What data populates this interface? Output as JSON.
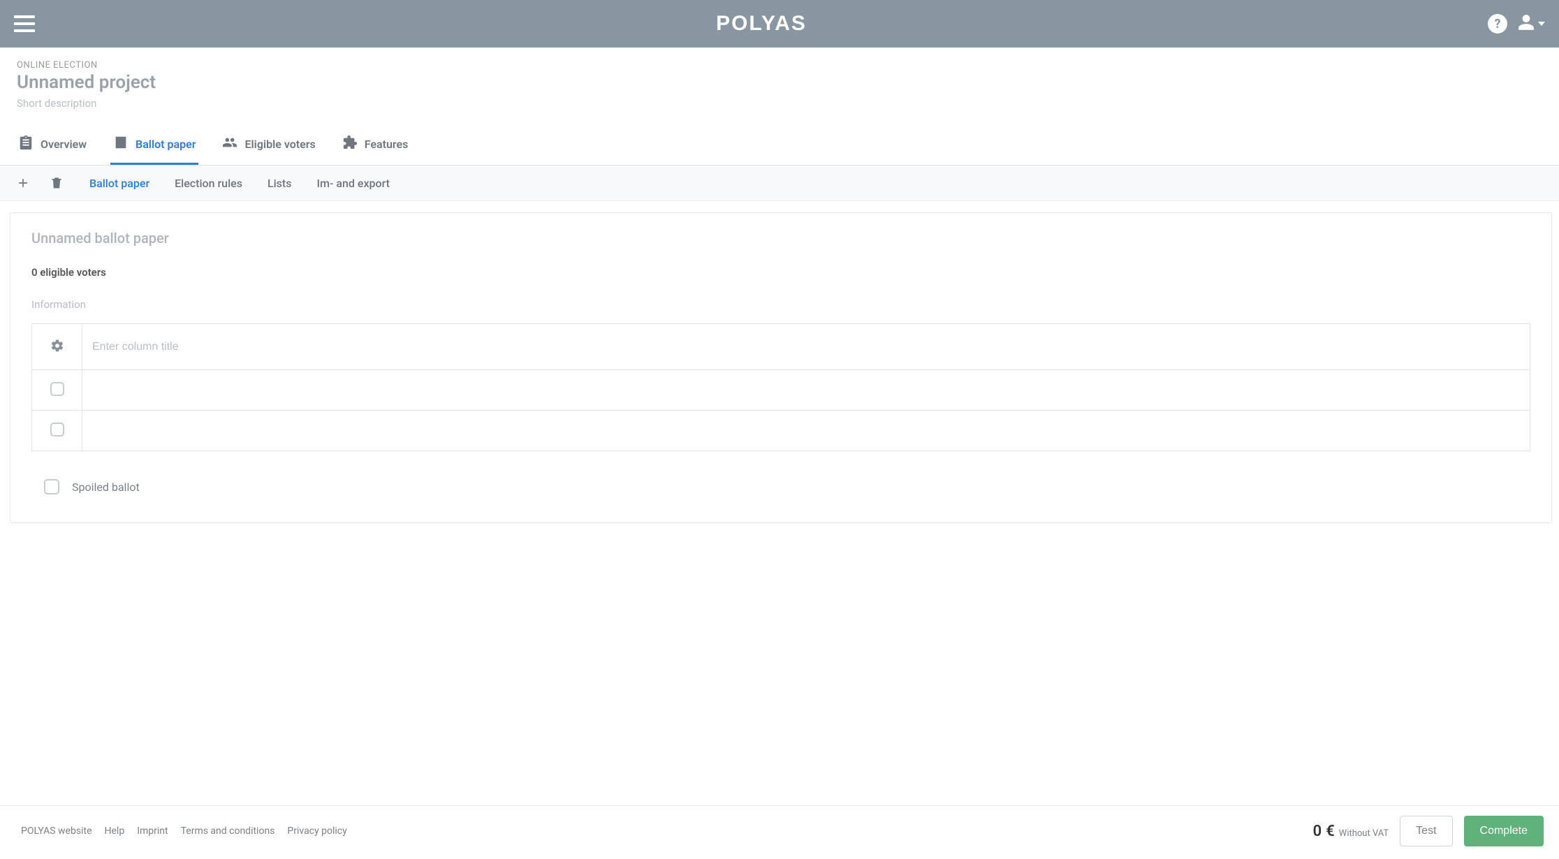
{
  "brand": "POLYAS",
  "project": {
    "eyebrow": "ONLINE ELECTION",
    "title": "Unnamed project",
    "description": "Short description"
  },
  "tabs": {
    "overview": "Overview",
    "ballot_paper": "Ballot paper",
    "eligible_voters": "Eligible voters",
    "features": "Features"
  },
  "subtabs": {
    "ballot_paper": "Ballot paper",
    "election_rules": "Election rules",
    "lists": "Lists",
    "im_export": "Im- and export"
  },
  "card": {
    "title": "Unnamed ballot paper",
    "voters_link": "0 eligible voters",
    "information_label": "Information",
    "column_placeholder": "Enter column title"
  },
  "spoiled": {
    "label": "Spoiled ballot"
  },
  "footer": {
    "links": {
      "website": "POLYAS website",
      "help": "Help",
      "imprint": "Imprint",
      "terms": "Terms and conditions",
      "privacy": "Privacy policy"
    },
    "price_value": "0",
    "price_currency": "€",
    "price_note": "Without VAT",
    "test_btn": "Test",
    "complete_btn": "Complete"
  }
}
